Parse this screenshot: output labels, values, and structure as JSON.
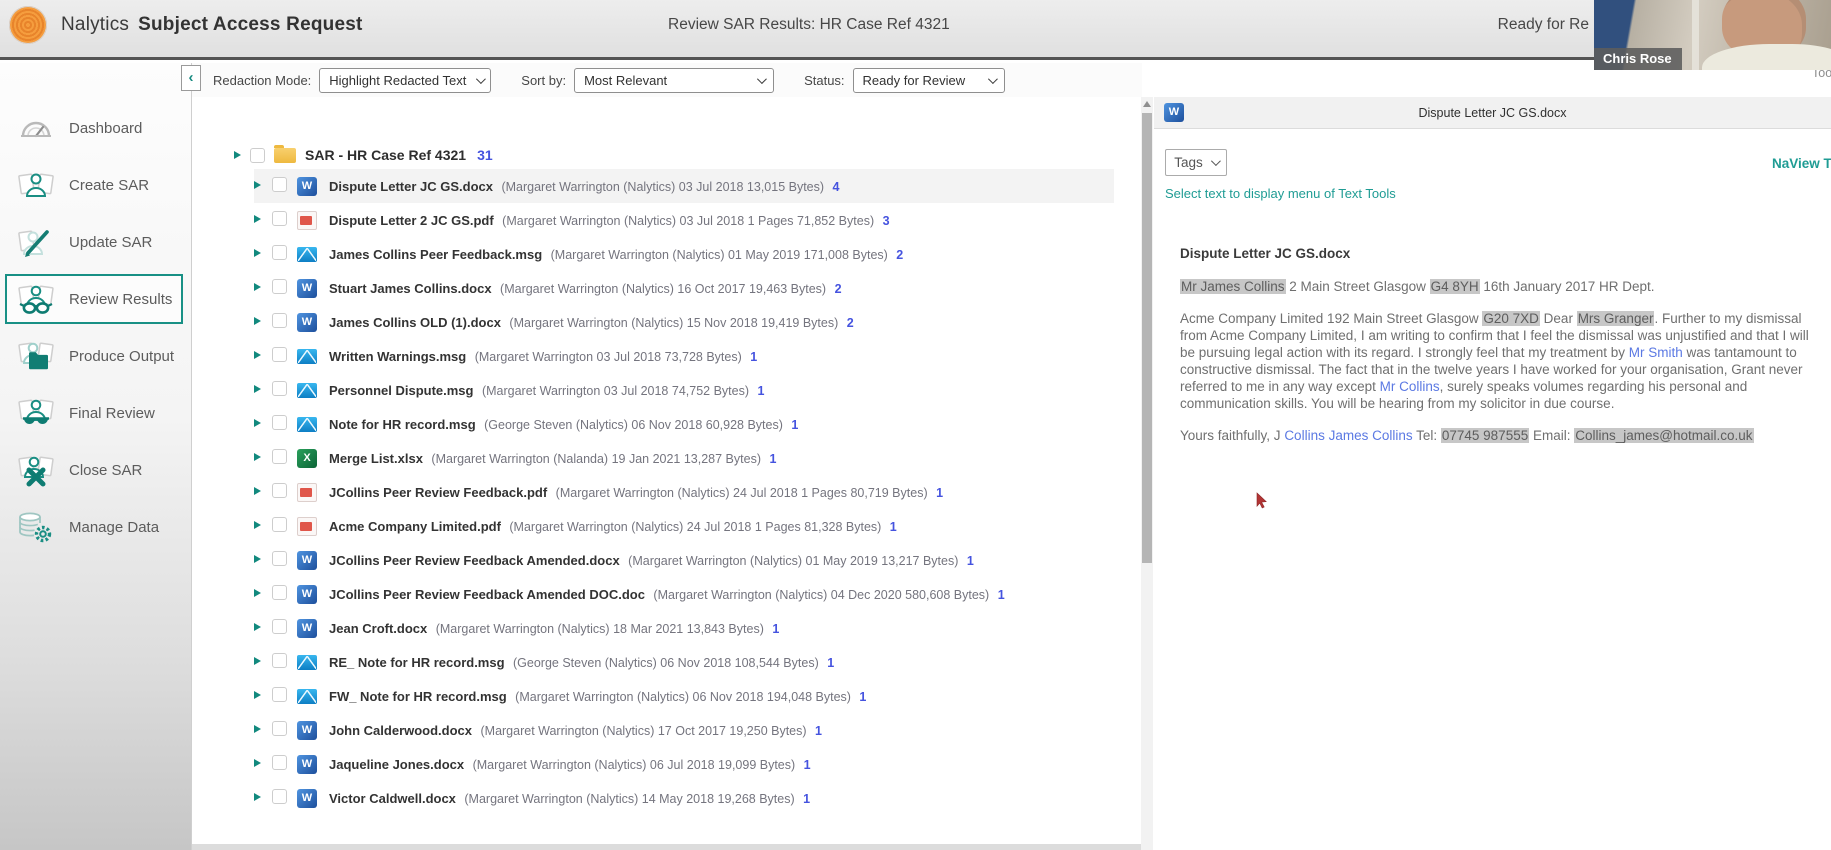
{
  "header": {
    "brand": "Nalytics",
    "app_title": "Subject Access Request",
    "center_title": "Review SAR Results:  HR Case Ref 4321",
    "right_status": "Ready for Re",
    "webcam_label": "Chris Rose",
    "tools_cut": "Too"
  },
  "sidebar": {
    "items": [
      {
        "label": "Dashboard",
        "icon": "dashboard-gauge"
      },
      {
        "label": "Create SAR",
        "icon": "person-documents"
      },
      {
        "label": "Update SAR",
        "icon": "pencil-documents"
      },
      {
        "label": "Review Results",
        "icon": "reading-glasses",
        "selected": true
      },
      {
        "label": "Produce Output",
        "icon": "folder-output"
      },
      {
        "label": "Final Review",
        "icon": "sunglasses"
      },
      {
        "label": "Close SAR",
        "icon": "close-x"
      },
      {
        "label": "Manage Data",
        "icon": "database-gear"
      }
    ]
  },
  "toolbar": {
    "collapse_glyph": "‹",
    "redaction_label": "Redaction Mode:",
    "redaction_value": "Highlight Redacted Text",
    "sort_label": "Sort by:",
    "sort_value": "Most Relevant",
    "status_label": "Status:",
    "status_value": "Ready for Review"
  },
  "file_tree": {
    "root": {
      "name": "SAR - HR Case Ref 4321",
      "count": "31"
    },
    "files": [
      {
        "icon": "word",
        "name": "Dispute Letter JC GS.docx",
        "meta": "(Margaret Warrington (Nalytics)  03 Jul 2018  13,015 Bytes)",
        "count": "4",
        "selected": true
      },
      {
        "icon": "pdf",
        "name": "Dispute Letter 2 JC GS.pdf",
        "meta": "(Margaret Warrington (Nalytics)  03 Jul 2018  1 Pages  71,852 Bytes)",
        "count": "3"
      },
      {
        "icon": "msg",
        "name": "James Collins Peer Feedback.msg",
        "meta": "(Margaret Warrington (Nalytics)  01 May 2019  171,008 Bytes)",
        "count": "2"
      },
      {
        "icon": "word",
        "name": "Stuart James Collins.docx",
        "meta": "(Margaret Warrington (Nalytics)  16 Oct 2017  19,463 Bytes)",
        "count": "2"
      },
      {
        "icon": "word",
        "name": "James Collins OLD (1).docx",
        "meta": "(Margaret Warrington (Nalytics)  15 Nov 2018  19,419 Bytes)",
        "count": "2"
      },
      {
        "icon": "msg",
        "name": "Written Warnings.msg",
        "meta": "(Margaret Warrington  03 Jul 2018  73,728 Bytes)",
        "count": "1"
      },
      {
        "icon": "msg",
        "name": "Personnel Dispute.msg",
        "meta": "(Margaret Warrington  03 Jul 2018  74,752 Bytes)",
        "count": "1"
      },
      {
        "icon": "msg",
        "name": "Note for HR record.msg",
        "meta": "(George Steven (Nalytics)  06 Nov 2018  60,928 Bytes)",
        "count": "1"
      },
      {
        "icon": "excel",
        "name": "Merge List.xlsx",
        "meta": "(Margaret Warrington (Nalanda)  19 Jan 2021  13,287 Bytes)",
        "count": "1"
      },
      {
        "icon": "pdf",
        "name": "JCollins Peer Review Feedback.pdf",
        "meta": "(Margaret Warrington (Nalytics)  24 Jul 2018  1 Pages  80,719 Bytes)",
        "count": "1"
      },
      {
        "icon": "pdf",
        "name": "Acme Company Limited.pdf",
        "meta": "(Margaret Warrington (Nalytics)  24 Jul 2018  1 Pages  81,328 Bytes)",
        "count": "1"
      },
      {
        "icon": "word",
        "name": "JCollins Peer Review Feedback Amended.docx",
        "meta": "(Margaret Warrington (Nalytics)  01 May 2019  13,217 Bytes)",
        "count": "1"
      },
      {
        "icon": "word",
        "name": "JCollins Peer Review Feedback Amended DOC.doc",
        "meta": "(Margaret Warrington (Nalytics)  04 Dec 2020  580,608 Bytes)",
        "count": "1"
      },
      {
        "icon": "word",
        "name": "Jean Croft.docx",
        "meta": "(Margaret Warrington (Nalytics)  18 Mar 2021  13,843 Bytes)",
        "count": "1"
      },
      {
        "icon": "msg",
        "name": "RE_ Note for HR record.msg",
        "meta": "(George Steven (Nalytics)  06 Nov 2018  108,544 Bytes)",
        "count": "1"
      },
      {
        "icon": "msg",
        "name": "FW_ Note for HR record.msg",
        "meta": "(Margaret Warrington (Nalytics)  06 Nov 2018  194,048 Bytes)",
        "count": "1"
      },
      {
        "icon": "word",
        "name": "John Calderwood.docx",
        "meta": "(Margaret Warrington (Nalytics)  17 Oct 2017  19,250 Bytes)",
        "count": "1"
      },
      {
        "icon": "word",
        "name": "Jaqueline Jones.docx",
        "meta": "(Margaret Warrington (Nalytics)  06 Jul 2018  19,099 Bytes)",
        "count": "1"
      },
      {
        "icon": "word",
        "name": "Victor Caldwell.docx",
        "meta": "(Margaret Warrington (Nalytics)  14 May 2018  19,268 Bytes)",
        "count": "1"
      }
    ]
  },
  "preview": {
    "panel_title": "Dispute Letter JC GS.docx",
    "tags_label": "Tags",
    "naview_label": "NaView To",
    "hint": "Select text to display menu of Text Tools",
    "doc_heading": "Dispute Letter JC GS.docx",
    "p1": [
      {
        "t": "Mr James Collins",
        "s": "hl"
      },
      {
        "t": " 2 Main Street Glasgow ",
        "s": ""
      },
      {
        "t": "G4 8YH",
        "s": "hl"
      },
      {
        "t": " 16th January 2017 HR Dept.",
        "s": ""
      }
    ],
    "p2": [
      {
        "t": "Acme Company Limited 192 Main Street Glasgow ",
        "s": ""
      },
      {
        "t": "G20 7XD",
        "s": "hl"
      },
      {
        "t": " Dear ",
        "s": ""
      },
      {
        "t": "Mrs Granger",
        "s": "hl"
      },
      {
        "t": ". Further to my dismissal from Acme Company Limited, I am writing to confirm that I feel the dismissal was unjustified and that I will be pursuing legal action with its regard. I strongly feel that my treatment by ",
        "s": ""
      },
      {
        "t": "Mr Smith",
        "s": "link"
      },
      {
        "t": " was tantamount to constructive dismissal. The fact that in the twelve years I have worked for your organisation, Grant never referred to me in any way except ",
        "s": ""
      },
      {
        "t": "Mr Collins",
        "s": "link"
      },
      {
        "t": ", surely speaks volumes regarding his personal and communication skills. You will be hearing from my solicitor in due course.",
        "s": ""
      }
    ],
    "p3": [
      {
        "t": "Yours faithfully, J ",
        "s": ""
      },
      {
        "t": "Collins James Collins",
        "s": "link"
      },
      {
        "t": " Tel: ",
        "s": ""
      },
      {
        "t": "07745 987555",
        "s": "hl"
      },
      {
        "t": " Email: ",
        "s": ""
      },
      {
        "t": "Collins_james@hotmail.co.uk",
        "s": "hl"
      }
    ]
  },
  "colors": {
    "accent_teal": "#18897f",
    "count_blue": "#4553df",
    "link_blue": "#5b79e3",
    "highlight_grey": "#c7c7c7",
    "logo_orange": "#f2953c",
    "word_blue": "#2b67b5",
    "excel_green": "#168a4e",
    "pdf_red": "#e0564a",
    "msg_blue": "#1e9ad6",
    "folder_yellow": "#f0c04a"
  }
}
